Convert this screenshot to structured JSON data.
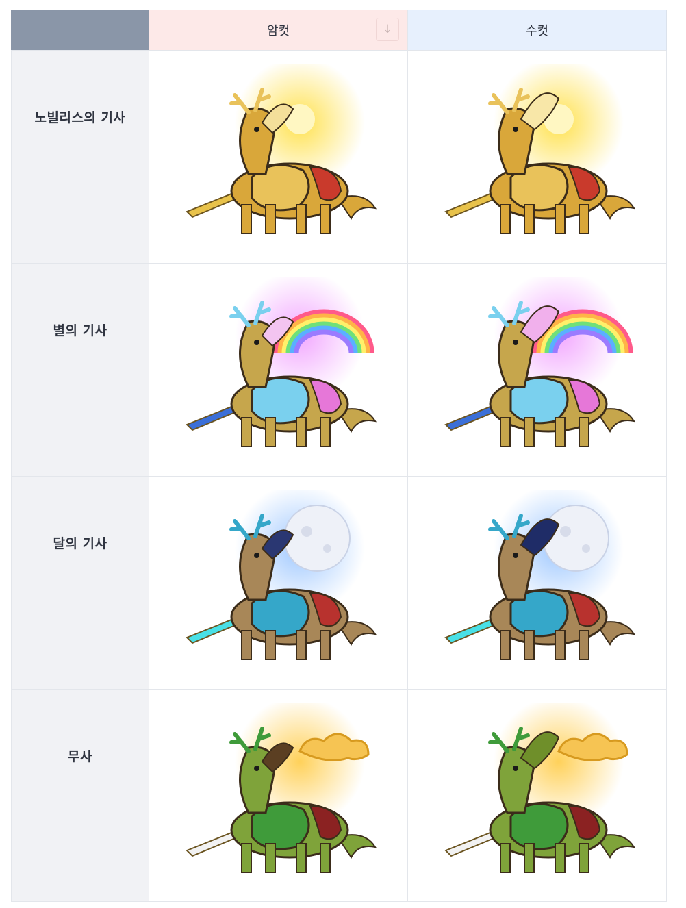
{
  "header": {
    "female_label": "암컷",
    "male_label": "수컷",
    "sort_icon": "arrow-down-icon"
  },
  "rows": [
    {
      "label": "노빌리스의 기사",
      "theme": "sun",
      "colors": {
        "glow": "#ffe14d",
        "body": "#d9a73a",
        "armor": "#e9c25a",
        "accent": "#c93a2c",
        "weapon": "#e8c24a",
        "hair_f": "#f4df9a",
        "hair_m": "#f8e7a8"
      }
    },
    {
      "label": "별의 기사",
      "theme": "rainbow",
      "colors": {
        "glow": "#f2a7ff",
        "body": "#c6a64c",
        "armor": "#7ad0ee",
        "accent": "#e677d8",
        "weapon": "#3b6fd8",
        "hair_f": "#f3c4f0",
        "hair_m": "#f1b0ec"
      }
    },
    {
      "label": "달의 기사",
      "theme": "moon",
      "colors": {
        "glow": "#9fc8ff",
        "body": "#a88758",
        "armor": "#35a7c9",
        "accent": "#b8322e",
        "weapon": "#49e0e6",
        "hair_f": "#2a3772",
        "hair_m": "#1f2c67"
      }
    },
    {
      "label": "무사",
      "theme": "cloud",
      "colors": {
        "glow": "#ffd15a",
        "body": "#7fa33a",
        "armor": "#3f9b3a",
        "accent": "#8b2222",
        "weapon": "#f2f2f2",
        "hair_f": "#5b3f22",
        "hair_m": "#6f8f2a"
      }
    }
  ]
}
